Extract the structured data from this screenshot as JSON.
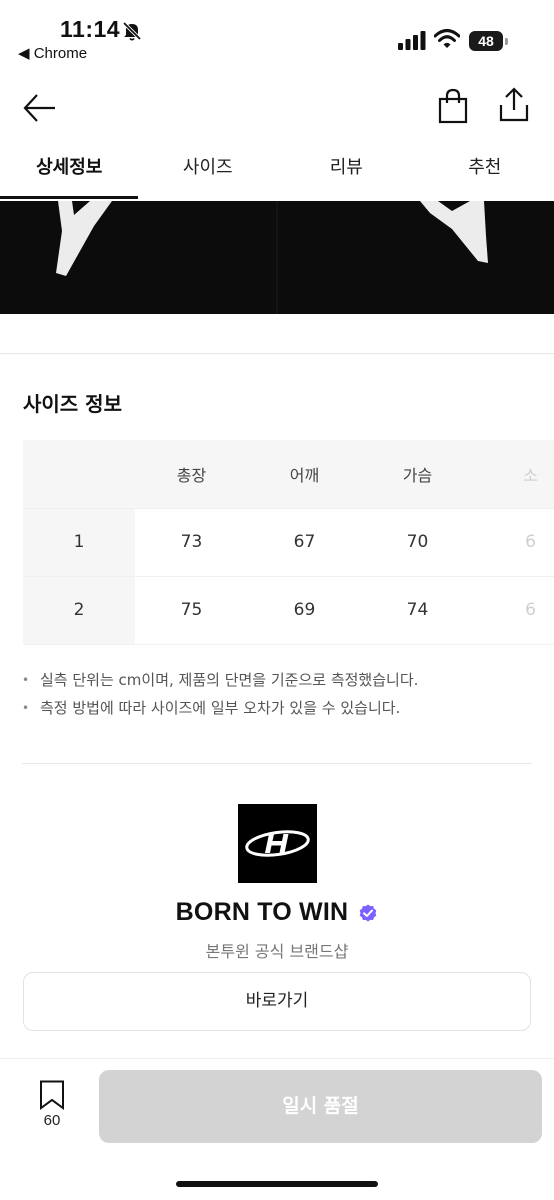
{
  "status_bar": {
    "time": "11:14",
    "back_app": "◀ Chrome",
    "battery": "48"
  },
  "nav": {
    "icons": [
      "back-arrow-icon",
      "shopping-bag-icon",
      "share-icon"
    ]
  },
  "tabs": [
    {
      "label": "상세정보",
      "active": true
    },
    {
      "label": "사이즈",
      "active": false
    },
    {
      "label": "리뷰",
      "active": false
    },
    {
      "label": "추천",
      "active": false
    }
  ],
  "size_section": {
    "title": "사이즈 정보",
    "headers": [
      "",
      "총장",
      "어깨",
      "가슴",
      "소"
    ],
    "rows": [
      {
        "size": "1",
        "values": [
          "73",
          "67",
          "70",
          "6"
        ]
      },
      {
        "size": "2",
        "values": [
          "75",
          "69",
          "74",
          "6"
        ]
      }
    ],
    "notes": [
      "실측 단위는 cm이며, 제품의 단면을 기준으로 측정했습니다.",
      "측정 방법에 따라 사이즈에 일부 오차가 있을 수 있습니다."
    ]
  },
  "brand": {
    "name": "BORN TO WIN",
    "subtitle": "본투윈 공식 브랜드샵",
    "goto_label": "바로가기",
    "verified_color": "#7b61ff"
  },
  "bottom_bar": {
    "bookmark_count": "60",
    "soldout_label": "일시 품절",
    "soldout_bg": "#d3d3d3"
  }
}
